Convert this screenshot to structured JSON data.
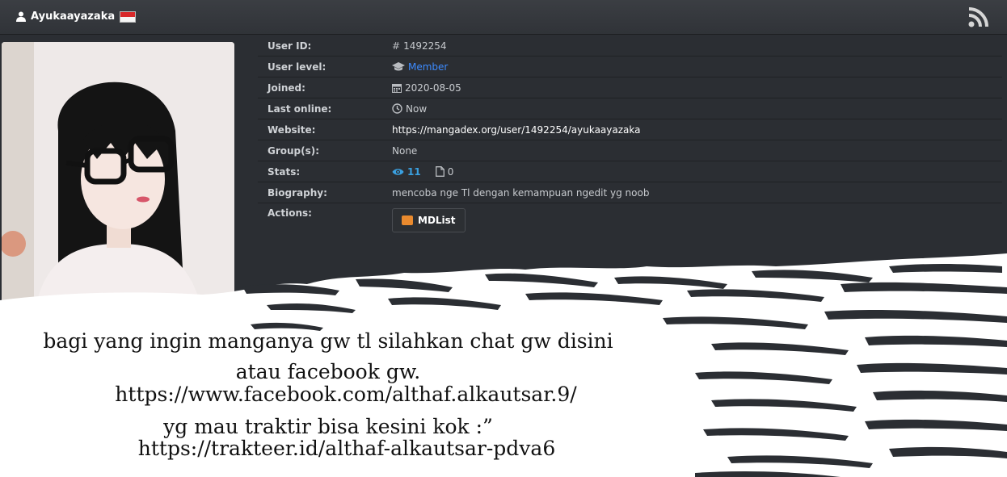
{
  "header": {
    "username": "Ayukaayazaka",
    "flag_colors": [
      "#d8282a",
      "#f5f5f5"
    ]
  },
  "profile": {
    "rows": [
      {
        "label": "User ID:",
        "icon": "hash-icon",
        "value": "1492254"
      },
      {
        "label": "User level:",
        "icon": "graduation-cap-icon",
        "value": "Member",
        "color": "#3d8bff"
      },
      {
        "label": "Joined:",
        "icon": "calendar-icon",
        "value": "2020-08-05"
      },
      {
        "label": "Last online:",
        "icon": "clock-icon",
        "value": "Now"
      },
      {
        "label": "Website:",
        "value": "https://mangadex.org/user/1492254/ayukaayazaka"
      },
      {
        "label": "Group(s):",
        "value": "None"
      },
      {
        "label": "Stats:",
        "views": "11",
        "uploads": "0"
      },
      {
        "label": "Biography:",
        "value": "mencoba nge Tl dengan kemampuan ngedit yg noob"
      },
      {
        "label": "Actions:",
        "button": "MDList"
      }
    ]
  },
  "caption": {
    "line1": "bagi yang ingin manganya gw tl silahkan chat gw disini",
    "line2": "atau facebook gw.",
    "line3": "https://www.facebook.com/althaf.alkautsar.9/",
    "line4": "yg mau traktir bisa kesini kok :”",
    "line5": "https://trakteer.id/althaf-alkautsar-pdva6"
  },
  "colors": {
    "accent": "#3d8bff",
    "background": "#2b2e33"
  }
}
